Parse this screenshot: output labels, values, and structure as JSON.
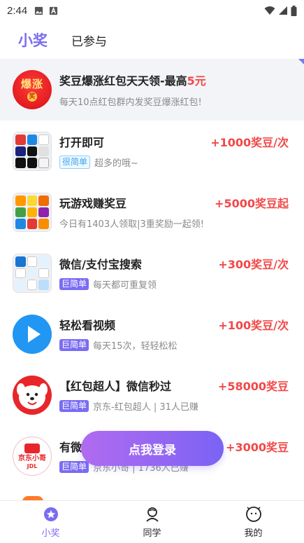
{
  "status_bar": {
    "time": "2:44"
  },
  "tabs": {
    "main": "小奖",
    "secondary": "已参与"
  },
  "banner": {
    "logo_text": "爆涨",
    "logo_coin": "奖",
    "title_prefix": "奖豆爆涨红包天天领-最高",
    "title_highlight": "5元",
    "desc": "每天10点红包群内发奖豆爆涨红包!"
  },
  "tasks": [
    {
      "title": "打开即可",
      "reward": "+1000奖豆/次",
      "badge": "很简单",
      "badge_type": "easy",
      "desc": "超多的哦~",
      "icon": "app-grid-icon"
    },
    {
      "title": "玩游戏赚奖豆",
      "reward": "+5000奖豆起",
      "badge": "",
      "badge_type": "",
      "desc": "今日有1403人领取|3重奖励一起领!",
      "icon": "game-grid-icon"
    },
    {
      "title": "微信/支付宝搜索",
      "reward": "+300奖豆/次",
      "badge": "巨简单",
      "badge_type": "hard",
      "desc": "每天都可重复领",
      "icon": "search-grid-icon"
    },
    {
      "title": "轻松看视频",
      "reward": "+100奖豆/次",
      "badge": "巨简单",
      "badge_type": "hard",
      "desc": "每天15次，轻轻松松",
      "icon": "play-icon"
    },
    {
      "title": "【红包超人】微信秒过",
      "reward": "+58000奖豆",
      "badge": "巨简单",
      "badge_type": "hard",
      "desc": "京东-红包超人 | 31人已赚",
      "icon": "jd-dog-icon"
    },
    {
      "title": "有微",
      "reward": "+3000奖豆",
      "badge": "巨简单",
      "badge_type": "hard",
      "desc": "京东小哥 | 1736人已赚",
      "icon": "jd-courier-icon",
      "icon_text": "京东小哥",
      "icon_subtext": "JDL"
    }
  ],
  "login_button": "点我登录",
  "bottom_nav": [
    {
      "label": "小奖",
      "icon": "star-badge-icon",
      "active": true
    },
    {
      "label": "同学",
      "icon": "classmate-icon",
      "active": false
    },
    {
      "label": "我的",
      "icon": "face-icon",
      "active": false
    }
  ],
  "colors": {
    "accent": "#7a6cf2",
    "reward": "#f24848",
    "badge_easy": "#3ea4f2"
  }
}
